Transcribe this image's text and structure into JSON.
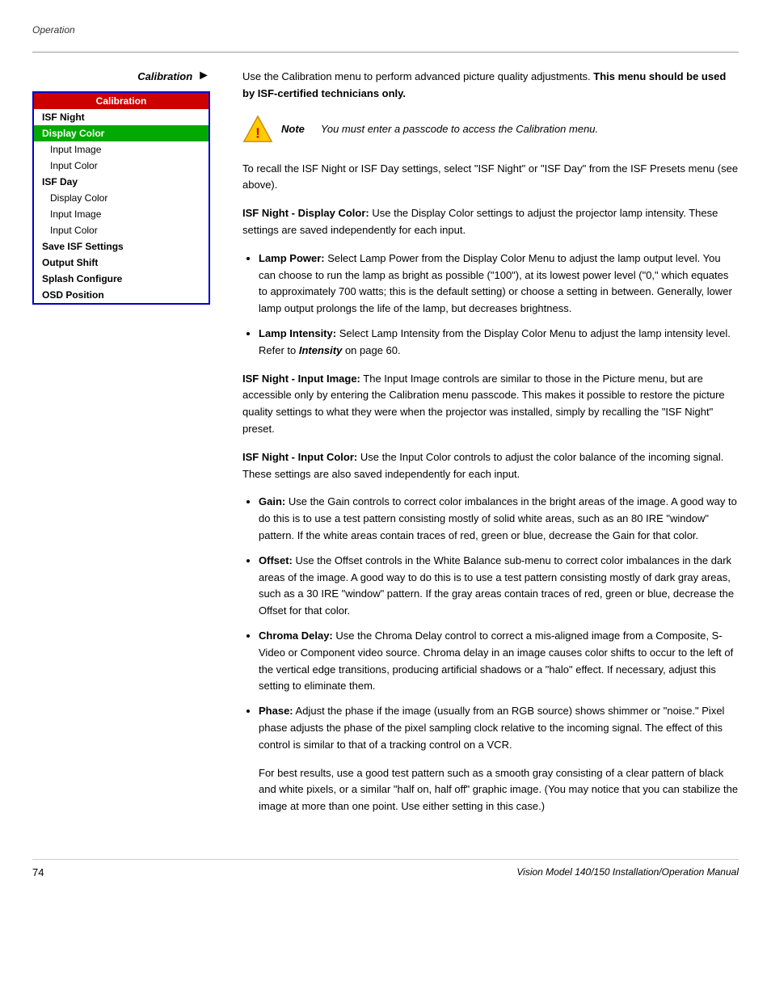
{
  "page": {
    "operation_label": "Operation",
    "page_number": "74",
    "footer_title": "Vision Model 140/150 Installation/Operation Manual"
  },
  "calibration_section": {
    "arrow_label": "Calibration",
    "intro_text": "Use the Calibration menu to perform advanced picture quality adjustments.",
    "intro_bold": "This menu should be used by ISF-certified technicians only.",
    "note_label": "Note",
    "note_text": "You must enter a passcode to access the Calibration menu.",
    "recall_text": "To recall the ISF Night or ISF Day settings, select \"ISF Night\" or \"ISF Day\" from the ISF Presets menu (see above)."
  },
  "menu": {
    "header": "Calibration",
    "items": [
      {
        "label": "ISF Night",
        "style": "bold",
        "indent": false
      },
      {
        "label": "Display Color",
        "style": "highlight-green",
        "indent": false
      },
      {
        "label": "Input Image",
        "style": "normal",
        "indent": true
      },
      {
        "label": "Input Color",
        "style": "normal",
        "indent": true
      },
      {
        "label": "ISF Day",
        "style": "bold",
        "indent": false
      },
      {
        "label": "Display Color",
        "style": "normal",
        "indent": true
      },
      {
        "label": "Input Image",
        "style": "normal",
        "indent": true
      },
      {
        "label": "Input Color",
        "style": "normal",
        "indent": true
      },
      {
        "label": "Save ISF Settings",
        "style": "bold",
        "indent": false
      },
      {
        "label": "Output Shift",
        "style": "bold",
        "indent": false
      },
      {
        "label": "Splash Configure",
        "style": "bold",
        "indent": false
      },
      {
        "label": "OSD Position",
        "style": "bold",
        "indent": false
      }
    ]
  },
  "sections": [
    {
      "id": "isf-night-display-color",
      "heading": "ISF Night - Display Color:",
      "text": "Use the Display Color settings to adjust the projector lamp intensity. These settings are saved independently for each input."
    },
    {
      "id": "isf-night-input-image",
      "heading": "ISF Night - Input Image:",
      "text": "The Input Image controls are similar to those in the Picture menu, but are accessible only by entering the Calibration menu passcode. This makes it possible to restore the picture quality settings to what they were when the projector was installed, simply by recalling the \"ISF Night\" preset."
    },
    {
      "id": "isf-night-input-color",
      "heading": "ISF Night - Input Color:",
      "text": "Use the Input Color controls to adjust the color balance of the incoming signal. These settings are also saved independently for each input."
    }
  ],
  "bullets": {
    "display_color": [
      {
        "term": "Lamp Power:",
        "text": "Select Lamp Power from the Display Color Menu to adjust the lamp output level. You can choose to run the lamp as bright as possible (\"100\"), at its lowest power level (\"0,\" which equates to approximately 700 watts; this is the default setting) or choose a setting in between. Generally, lower lamp output prolongs the life of the lamp, but decreases brightness."
      },
      {
        "term": "Lamp Intensity:",
        "text": "Select Lamp Intensity from the Display Color Menu to adjust the lamp intensity level. Refer to Intensity on page 60."
      }
    ],
    "input_color": [
      {
        "term": "Gain:",
        "text": "Use the Gain controls to correct color imbalances in the bright areas of the image. A good way to do this is to use a test pattern consisting mostly of solid white areas, such as an 80 IRE \"window\" pattern. If the white areas contain traces of red, green or blue, decrease the Gain for that color."
      },
      {
        "term": "Offset:",
        "text": "Use the Offset controls in the White Balance sub-menu to correct color imbalances in the dark areas of the image. A good way to do this is to use a test pattern consisting mostly of dark gray areas, such as a 30 IRE \"window\" pattern. If the gray areas contain traces of red, green or blue, decrease the Offset for that color."
      },
      {
        "term": "Chroma Delay:",
        "text": "Use the Chroma Delay control to correct a mis-aligned image from a Composite, S-Video or Component video source. Chroma delay in an image causes color shifts to occur to the left of the vertical edge transitions, producing artificial shadows or a \"halo\" effect. If necessary, adjust this setting to eliminate them."
      },
      {
        "term": "Phase:",
        "text": "Adjust the phase if the image (usually from an RGB source) shows shimmer or \"noise.\" Pixel phase adjusts the phase of the pixel sampling clock relative to the incoming signal. The effect of this control is similar to that of a tracking control on a VCR."
      }
    ]
  },
  "phase_extra": "For best results, use a good test pattern such as a smooth gray consisting of a clear pattern of black and white pixels, or a similar \"half on, half off\" graphic image. (You may notice that you can stabilize the image at more than one point. Use either setting in this case.)",
  "intensity_link_text": "Intensity"
}
